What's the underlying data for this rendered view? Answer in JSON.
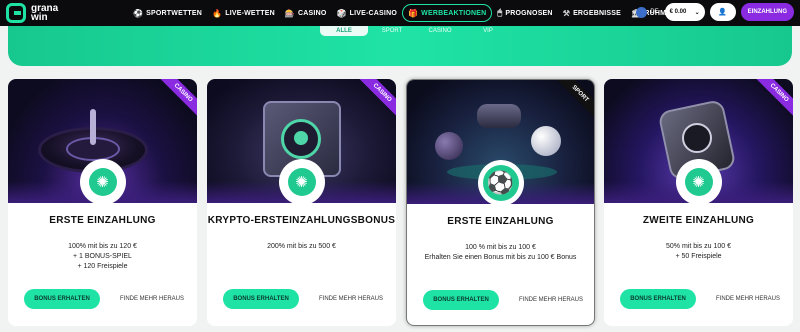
{
  "brand": {
    "name_line1": "grana",
    "name_line2": "win"
  },
  "nav": [
    {
      "icon": "soccer-ball-icon",
      "glyph": "⚽",
      "label": "SPORTWETTEN"
    },
    {
      "icon": "fire-icon",
      "glyph": "🔥",
      "label": "LIVE-WETTEN"
    },
    {
      "icon": "casino-icon",
      "glyph": "🎰",
      "label": "CASINO"
    },
    {
      "icon": "live-casino-icon",
      "glyph": "🎲",
      "label": "LIVE-CASINO"
    },
    {
      "icon": "gift-icon",
      "glyph": "🎁",
      "label": "WERBEAKTIONEN",
      "active": true
    },
    {
      "icon": "prediction-icon",
      "glyph": "🖱",
      "label": "PROGNOSEN"
    },
    {
      "icon": "results-icon",
      "glyph": "⚒",
      "label": "ERGEBNISSE"
    },
    {
      "icon": "hall-of-fame-icon",
      "glyph": "🏛",
      "label": "RUHMESHALLE"
    }
  ],
  "header": {
    "language": "DE",
    "balance": "€ 0.00",
    "deposit_label": "EINZAHLUNG"
  },
  "filters": [
    "ALLE",
    "SPORT",
    "CASINO",
    "VIP"
  ],
  "cards": [
    {
      "tag": "CASINO",
      "title": "ERSTE EINZAHLUNG",
      "desc": [
        "100% mit bis zu 120 €",
        "+ 1 BONUS-SPIEL",
        "+ 120 Freispiele"
      ],
      "cta": "BONUS ERHALTEN",
      "more": "FINDE MEHR HERAUS"
    },
    {
      "tag": "CASINO",
      "title": "KRYPTO-ERSTEINZAHLUNGSBONUS",
      "desc": [
        "200% mit bis zu 500 €"
      ],
      "cta": "BONUS ERHALTEN",
      "more": "FINDE MEHR HERAUS"
    },
    {
      "tag": "SPORT",
      "title": "ERSTE EINZAHLUNG",
      "desc": [
        "100 % mit bis zu 100 €",
        "Erhalten Sie einen Bonus mit bis zu 100 € Bonus"
      ],
      "cta": "BONUS ERHALTEN",
      "more": "FINDE MEHR HERAUS"
    },
    {
      "tag": "CASINO",
      "title": "ZWEITE EINZAHLUNG",
      "desc": [
        "50% mit bis zu 100 €",
        "+ 50 Freispiele"
      ],
      "cta": "BONUS ERHALTEN",
      "more": "FINDE MEHR HERAUS"
    }
  ]
}
